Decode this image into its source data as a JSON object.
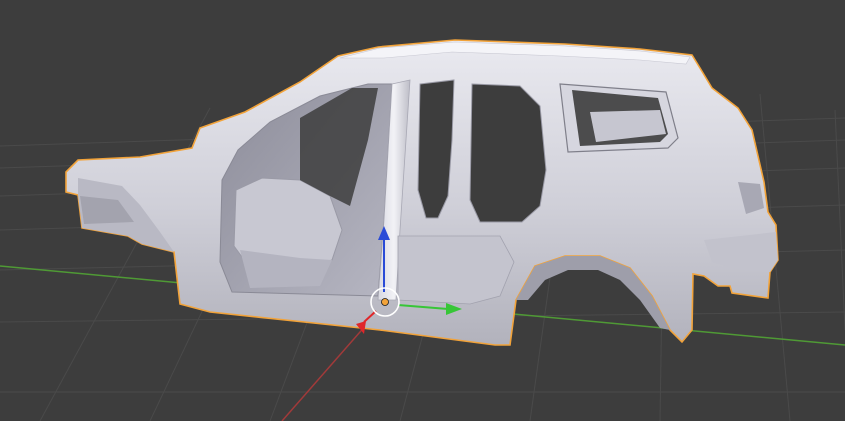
{
  "app": "3D viewport",
  "viewport": {
    "background": "#3d3d3d",
    "grid_color": "#4a4a4a",
    "x_axis_color": "#a13a3a",
    "y_axis_color": "#4f9a35",
    "selection_outline": "#f2a33a"
  },
  "selected_object": {
    "kind": "car-body-shell",
    "state": "selected",
    "material": "solid-gray"
  },
  "gizmo": {
    "type": "translate",
    "z_color": "#2a4bd7",
    "y_color": "#37c637",
    "x_color": "#e0262a",
    "origin_color": "#f2a33a"
  }
}
